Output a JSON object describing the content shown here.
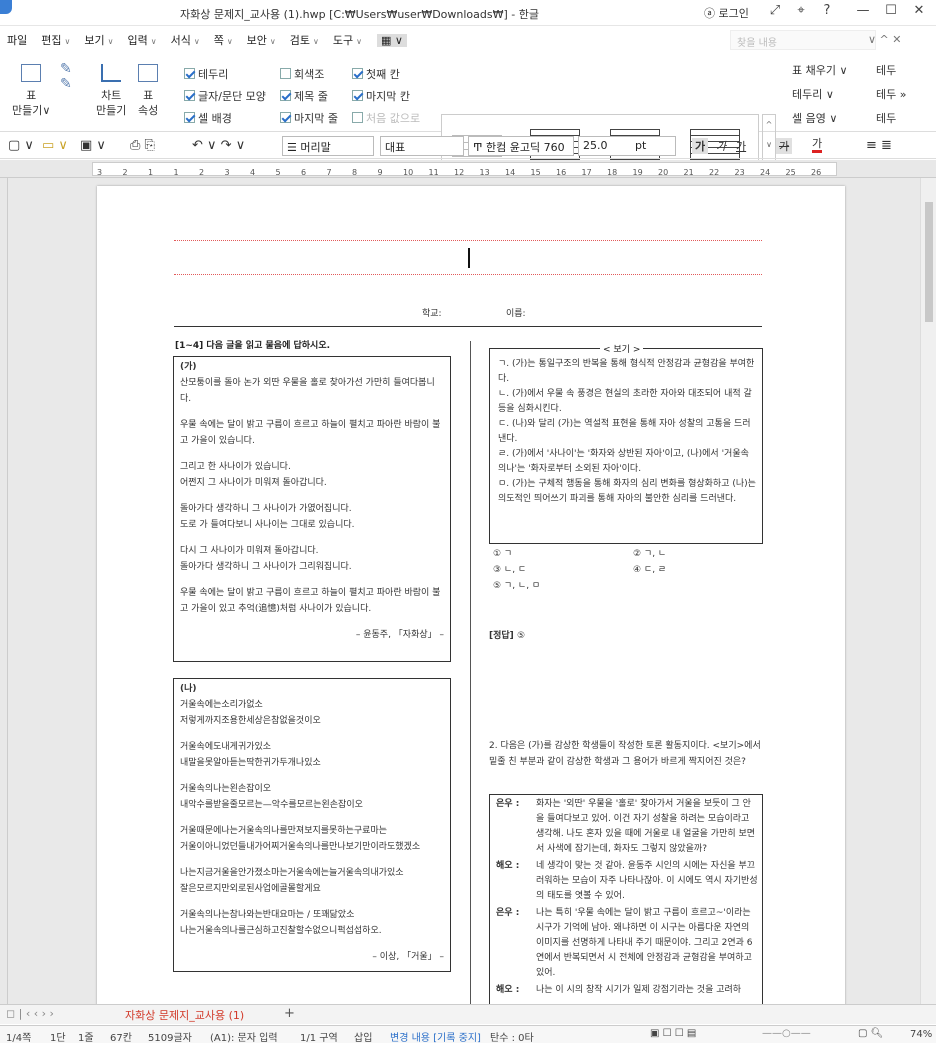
{
  "window": {
    "title": "자화상 문제지_교사용 (1).hwp [C:₩Users₩user₩Downloads₩] - 한글",
    "login": "로그인"
  },
  "menu": [
    {
      "label": "파일",
      "caret": ""
    },
    {
      "label": "편집",
      "caret": "∨"
    },
    {
      "label": "보기",
      "caret": "∨"
    },
    {
      "label": "입력",
      "caret": "∨"
    },
    {
      "label": "서식",
      "caret": "∨"
    },
    {
      "label": "쪽",
      "caret": "∨"
    },
    {
      "label": "보안",
      "caret": "∨"
    },
    {
      "label": "검토",
      "caret": "∨"
    },
    {
      "label": "도구",
      "caret": "∨"
    }
  ],
  "search_placeholder": "찾을 내용",
  "ribbon": {
    "table_make": "표\n만들기∨",
    "chart_make": "차트\n만들기",
    "table_prop": "표\n속성",
    "checks": [
      {
        "label": "테두리",
        "on": true
      },
      {
        "label": "회색조",
        "on": false
      },
      {
        "label": "첫째 칸",
        "on": true
      },
      {
        "label": "글자/문단 모양",
        "on": true
      },
      {
        "label": "제목 줄",
        "on": true
      },
      {
        "label": "마지막 칸",
        "on": true
      },
      {
        "label": "셀 배경",
        "on": true
      },
      {
        "label": "마지막 줄",
        "on": true
      },
      {
        "label": "처음 값으로",
        "on": false
      }
    ],
    "right": [
      "표 채우기 ∨",
      "테두",
      "테두리 ∨",
      "테두 »",
      "셀 음영 ∨",
      "테두"
    ]
  },
  "toolbar2": {
    "style": "머리말",
    "para": "대표",
    "font": "한컴 윤고딕 760",
    "size": "25.0",
    "unit": "pt",
    "bold": "가",
    "italic": "가",
    "underline": "가",
    "strike": "가",
    "color": "가"
  },
  "ruler": [
    "3",
    "2",
    "1",
    "1",
    "2",
    "3",
    "4",
    "5",
    "6",
    "7",
    "8",
    "9",
    "10",
    "11",
    "12",
    "13",
    "14",
    "15",
    "16",
    "17",
    "18",
    "19",
    "20",
    "21",
    "22",
    "23",
    "24",
    "25",
    "26"
  ],
  "doc": {
    "school": "학교:",
    "name": "이름:",
    "q1": "[1~4] 다음 글을 읽고 물음에 답하시오.",
    "ga": "(가)",
    "ga_text": [
      "산모퉁이를 돌아 논가 외딴 우물을 홀로 찾아가선 가만히 들여다봅니다.",
      "우물 속에는 달이 밝고 구름이 흐르고 하늘이 펼치고 파아란 바람이 불고 가을이 있습니다.",
      "그리고 한 사나이가 있습니다.\n어쩐지 그 사나이가 미워져 돌아갑니다.",
      "돌아가다 생각하니 그 사나이가 가엾어집니다.\n도로 가 들여다보니 사나이는 그대로 있습니다.",
      "다시 그 사나이가 미워져 돌아갑니다.\n돌아가다 생각하니 그 사나이가 그리워집니다.",
      "우물 속에는 달이 밝고 구름이 흐르고 하늘이 펼치고 파아란 바람이 불고 가을이 있고 추억(追憶)처럼 사나이가 있습니다."
    ],
    "ga_src": "– 윤동주, 「자화상」 –",
    "na": "(나)",
    "na_text": [
      "거울속에는소리가없소\n저렇게까지조용한세상은참없을것이오",
      "거울속에도내게귀가있소\n내말을못알아듣는딱한귀가두개나있소",
      "거울속의나는왼손잡이오\n내악수를받을줄모르는—악수를모르는왼손잡이오",
      "거울때문에나는거울속의나를만져보지를못하는구료마는\n거울이아니었던들내가어찌거울속의나를만나보기만이라도했겠소",
      "나는지금거울을안가졌소마는거울속에는늘거울속의내가있소\n잘은모르지만외로된사업에골몰할게요",
      "거울속의나는참나와는반대요마는 / 또꽤닮았소\n나는거울속의나를근심하고진찰할수없으니퍽섭섭하오."
    ],
    "na_src": "– 이상, 「거울」 –",
    "bogi_title": "< 보기 >",
    "bogi": [
      "ㄱ. (가)는 통일구조의 반복을 통해 형식적 안정감과 균형감을 부여한다.",
      "ㄴ. (가)에서 우물 속 풍경은 현실의 초라한 자아와 대조되어 내적 갈등을 심화시킨다.",
      "ㄷ. (나)와 달리 (가)는 역설적 표현을 통해 자아 성찰의 고통을 드러낸다.",
      "ㄹ. (가)에서 '사나이'는 '화자와 상반된 자아'이고, (나)에서 '거울속의나'는 '화자로부터 소외된 자아'이다.",
      "ㅁ. (가)는 구체적 행동을 통해 화자의 심리 변화를 형상화하고 (나)는 의도적인 띄어쓰기 파괴를 통해 자아의 불안한 심리를 드러낸다."
    ],
    "choices": [
      "① ㄱ",
      "② ㄱ, ㄴ",
      "③ ㄴ, ㄷ",
      "④ ㄷ, ㄹ",
      "⑤ ㄱ, ㄴ, ㅁ"
    ],
    "answer_label": "[정답]",
    "answer": "⑤",
    "q2": "2. 다음은 (가)를 감상한 학생들이 작성한 토론 활동지이다. <보기>에서 밑줄 친 부분과 같이 감상한 학생과 그 용어가 바르게 짝지어진 것은?",
    "dialog": [
      {
        "who": "은우",
        "text": "화자는 '외딴' 우물을 '홀로' 찾아가서 거울을 보듯이 그 안을 들여다보고 있어. 이건 자기 성찰을 하려는 모습이라고 생각해. 나도 혼자 있을 때에 거울로 내 얼굴을 가만히 보면서 사색에 잠기는데, 화자도 그렇지 않았을까?"
      },
      {
        "who": "해오",
        "text": "네 생각이 맞는 것 같아. 윤동주 시인의 시에는 자신을 부끄러워하는 모습이 자주 나타나잖아. 이 시에도 역시 자기반성의 태도를 엿볼 수 있어."
      },
      {
        "who": "은우",
        "text": "나는 특히 '우물 속에는 달이 밝고 구름이 흐르고~'이라는 시구가 기억에 남아. 왜냐하면 이 시구는 아름다운 자연의 이미지를 선명하게 나타내 주기 때문이야. 그리고 2연과 6연에서 반복되면서 시 전체에 안정감과 균형감을 부여하고 있어."
      },
      {
        "who": "해오",
        "text": "나는 이 시의 창작 시기가 일제 강점기라는 것을 고려하"
      }
    ]
  },
  "tab": "자화상 문제지_교사용 (1)",
  "status": [
    "1/4쪽",
    "1단",
    "1줄",
    "67칸",
    "5109글자",
    "(A1): 문자 입력",
    "1/1 구역",
    "삽입",
    "변경 내용 [기록 중지]",
    "탄수 : 0타",
    "74%"
  ]
}
